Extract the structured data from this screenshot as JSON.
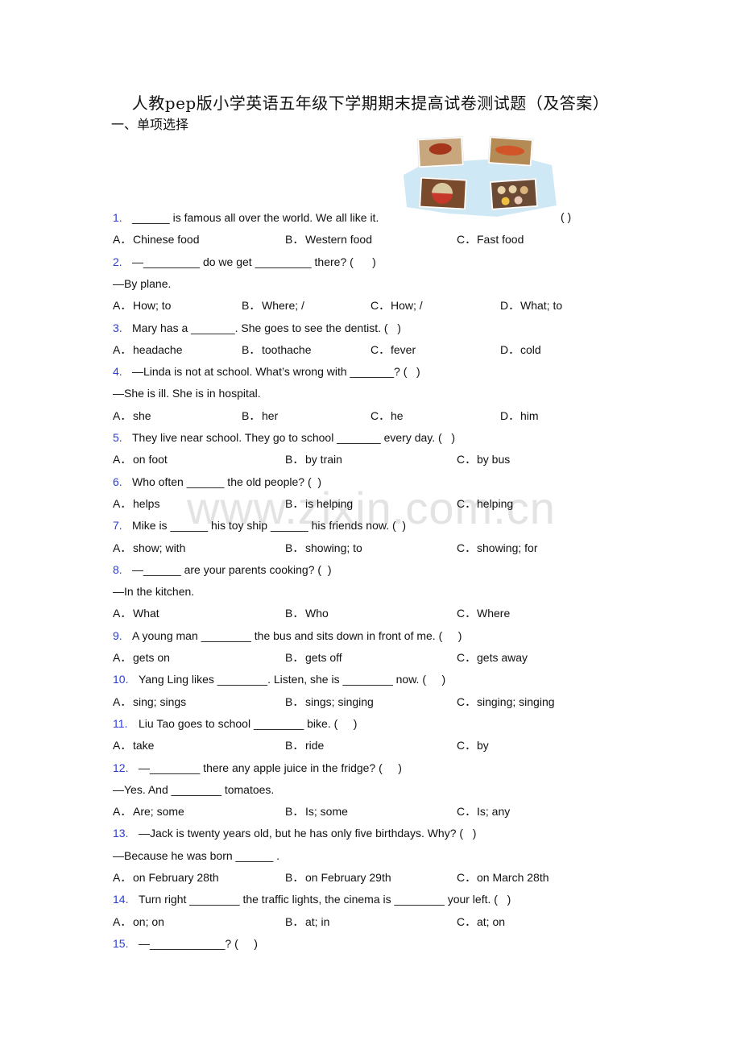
{
  "title": "人教pep版小学英语五年级下学期期末提高试卷测试题（及答案）",
  "section": "一、单项选择",
  "watermark": "www.zixin.com.cn",
  "image": {
    "name": "chinese-food-photos"
  },
  "questions": [
    {
      "num": "1.",
      "lines": [
        "______ is famous all over the world. We all like it."
      ],
      "paren": "( )",
      "options": [
        [
          "A．",
          "Chinese food"
        ],
        [
          "B．",
          "Western food"
        ],
        [
          "C．",
          "Fast food"
        ]
      ]
    },
    {
      "num": "2.",
      "lines": [
        "—_________ do we get _________ there? (      )",
        "—By plane."
      ],
      "options": [
        [
          "A．",
          "How; to"
        ],
        [
          "B．",
          "Where; /"
        ],
        [
          "C．",
          "How; /"
        ],
        [
          "D．",
          "What; to"
        ]
      ]
    },
    {
      "num": "3.",
      "lines": [
        "Mary has a _______. She goes to see the dentist. (   )"
      ],
      "options": [
        [
          "A．",
          "headache"
        ],
        [
          "B．",
          "toothache"
        ],
        [
          "C．",
          "fever"
        ],
        [
          "D．",
          "cold"
        ]
      ]
    },
    {
      "num": "4.",
      "lines": [
        "—Linda is not at school. What’s wrong with _______? (   )",
        "—She is ill. She is in hospital."
      ],
      "options": [
        [
          "A．",
          "she"
        ],
        [
          "B．",
          "her"
        ],
        [
          "C．",
          "he"
        ],
        [
          "D．",
          "him"
        ]
      ]
    },
    {
      "num": "5.",
      "lines": [
        "They live near school. They go to school _______ every day. (   )"
      ],
      "options": [
        [
          "A．",
          "on foot"
        ],
        [
          "B．",
          "by train"
        ],
        [
          "C．",
          "by bus"
        ]
      ]
    },
    {
      "num": "6.",
      "lines": [
        "Who often ______ the old people? (  )"
      ],
      "options": [
        [
          "A．",
          "helps"
        ],
        [
          "B．",
          "is helping"
        ],
        [
          "C．",
          "helping"
        ]
      ]
    },
    {
      "num": "7.",
      "lines": [
        "Mike is ______ his toy ship ______ his friends now. (  )"
      ],
      "options": [
        [
          "A．",
          "show; with"
        ],
        [
          "B．",
          "showing; to"
        ],
        [
          "C．",
          "showing; for"
        ]
      ]
    },
    {
      "num": "8.",
      "lines": [
        "—______ are your parents cooking? (  )",
        "—In the kitchen."
      ],
      "options": [
        [
          "A．",
          "What"
        ],
        [
          "B．",
          "Who"
        ],
        [
          "C．",
          "Where"
        ]
      ]
    },
    {
      "num": "9.",
      "lines": [
        "A young man ________ the bus and sits down in front of me. (     )"
      ],
      "options": [
        [
          "A．",
          "gets on"
        ],
        [
          "B．",
          "gets off"
        ],
        [
          "C．",
          "gets away"
        ]
      ]
    },
    {
      "num": "10.",
      "lines": [
        "Yang Ling likes ________. Listen, she is ________ now. (     )"
      ],
      "options": [
        [
          "A．",
          "sing; sings"
        ],
        [
          "B．",
          "sings; singing"
        ],
        [
          "C．",
          "singing; singing"
        ]
      ]
    },
    {
      "num": "11.",
      "lines": [
        "Liu Tao goes to school ________ bike. (     )"
      ],
      "options": [
        [
          "A．",
          "take"
        ],
        [
          "B．",
          "ride"
        ],
        [
          "C．",
          "by"
        ]
      ]
    },
    {
      "num": "12.",
      "lines": [
        "—________ there any apple juice in the fridge? (     )",
        "—Yes. And ________ tomatoes."
      ],
      "options": [
        [
          "A．",
          "Are; some"
        ],
        [
          "B．",
          "Is; some"
        ],
        [
          "C．",
          "Is; any"
        ]
      ]
    },
    {
      "num": "13.",
      "lines": [
        "—Jack is twenty years old, but he has only five birthdays. Why? (   )",
        "—Because he was born ______ ."
      ],
      "options": [
        [
          "A．",
          "on February 28th"
        ],
        [
          "B．",
          "on February 29th"
        ],
        [
          "C．",
          "on March 28th"
        ]
      ]
    },
    {
      "num": "14.",
      "lines": [
        "Turn right ________ the traffic lights, the cinema is ________ your left. (   )"
      ],
      "options": [
        [
          "A．",
          "on; on"
        ],
        [
          "B．",
          "at; in"
        ],
        [
          "C．",
          "at; on"
        ]
      ]
    },
    {
      "num": "15.",
      "lines": [
        "—____________? (     )"
      ],
      "options": []
    }
  ]
}
